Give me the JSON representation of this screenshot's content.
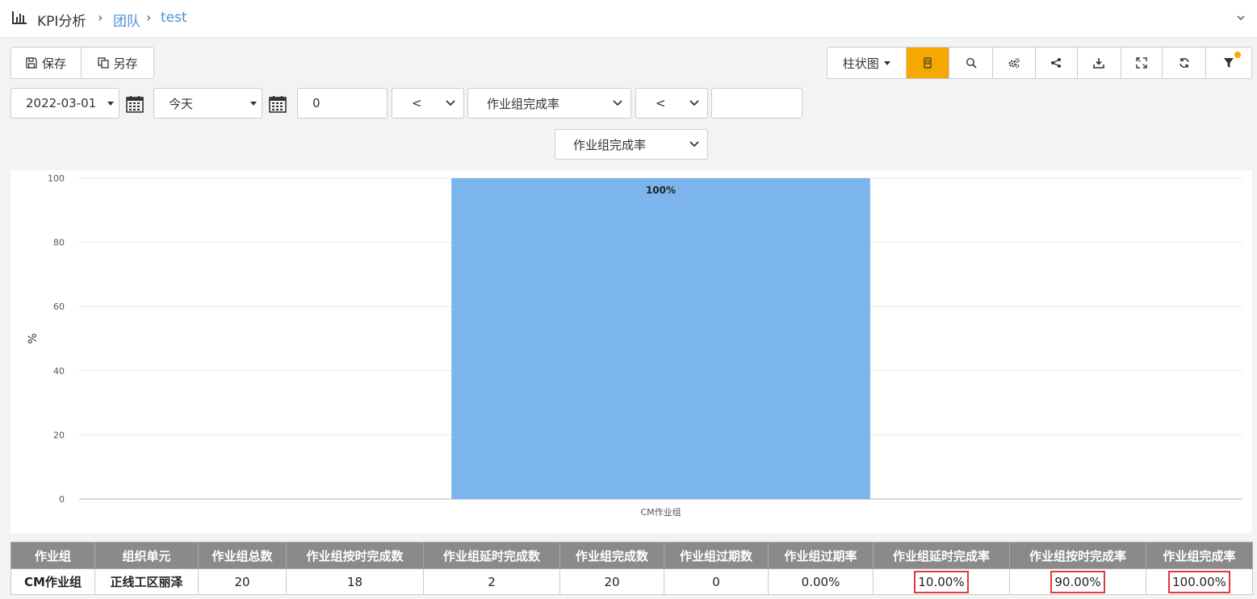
{
  "header": {
    "title": "KPI分析",
    "crumb_team": "团队",
    "crumb_report": "test"
  },
  "toolbar_left": {
    "save": "保存",
    "save_as": "另存"
  },
  "toolbar_right": {
    "chart_type": "柱状图",
    "active_color": "#f7a800"
  },
  "filters": {
    "start_date": "2022-03-01",
    "end_date": "今天",
    "number_value": "0",
    "operator1": "<",
    "metric1": "作业组完成率",
    "operator2": "<",
    "value2": "",
    "display_metric": "作业组完成率"
  },
  "chart_data": {
    "type": "bar",
    "categories": [
      "CM作业组"
    ],
    "values": [
      100
    ],
    "data_labels": [
      "100%"
    ],
    "ylabel": "%",
    "ylim": [
      0,
      100
    ],
    "yticks": [
      0,
      20,
      40,
      60,
      80,
      100
    ],
    "bar_color": "#7cb5ec",
    "grid": true
  },
  "table": {
    "headers": [
      "作业组",
      "组织单元",
      "作业组总数",
      "作业组按时完成数",
      "作业组延时完成数",
      "作业组完成数",
      "作业组过期数",
      "作业组过期率",
      "作业组延时完成率",
      "作业组按时完成率",
      "作业组完成率"
    ],
    "rows": [
      [
        "CM作业组",
        "正线工区丽泽",
        "20",
        "18",
        "2",
        "20",
        "0",
        "0.00%",
        "10.00%",
        "90.00%",
        "100.00%"
      ]
    ]
  }
}
